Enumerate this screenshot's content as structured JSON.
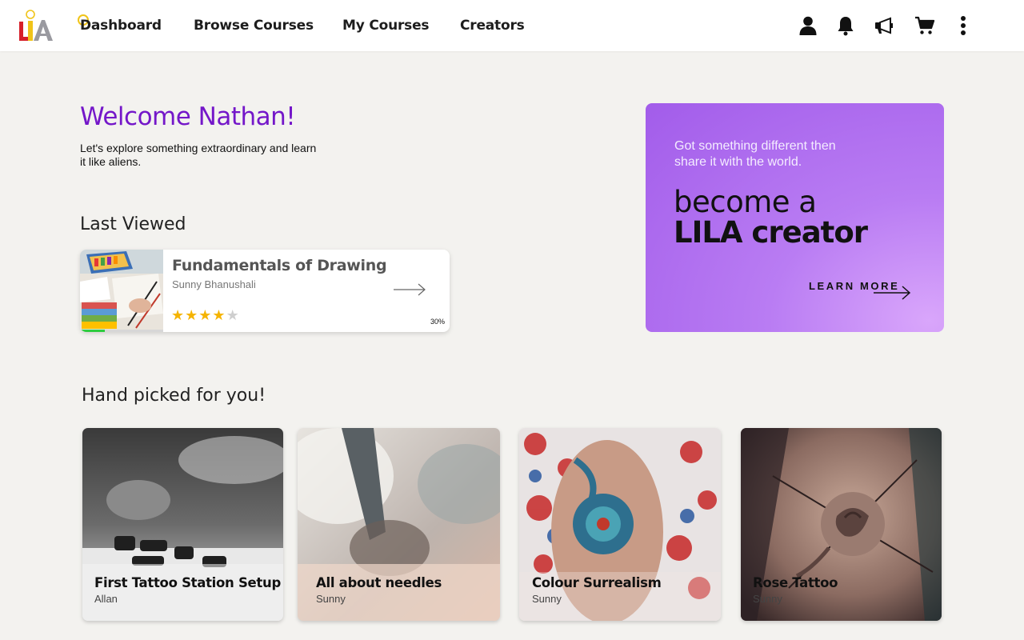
{
  "app": {
    "logo_text": "LILA"
  },
  "nav": {
    "links": [
      "Dashboard",
      "Browse Courses",
      "My Courses",
      "Creators"
    ],
    "icons": [
      "user-icon",
      "bell-icon",
      "megaphone-icon",
      "cart-icon",
      "more-vertical-icon"
    ]
  },
  "welcome": {
    "title": "Welcome Nathan!",
    "subtitle": "Let's explore something extraordinary and learn it like aliens."
  },
  "last_viewed": {
    "heading": "Last Viewed",
    "course": {
      "title": "Fundamentals of Drawing",
      "author": "Sunny Bhanushali",
      "progress_label": "30%",
      "progress": 0.3,
      "rating": 4,
      "rating_max": 5
    }
  },
  "promo": {
    "subtitle": "Got something different then share it with the world.",
    "line1": "become a",
    "line2": "LILA creator",
    "cta": "LEARN MORE"
  },
  "picks": {
    "heading": "Hand picked for you!",
    "items": [
      {
        "title": "First Tattoo Station Setup",
        "author": "Allan"
      },
      {
        "title": "All about needles",
        "author": "Sunny"
      },
      {
        "title": "Colour Surrealism",
        "author": "Sunny"
      },
      {
        "title": "Rose Tattoo",
        "author": "Sunny"
      }
    ]
  },
  "colors": {
    "accent": "#7417c9",
    "promo": "#a25cea",
    "star": "#f5b400"
  }
}
